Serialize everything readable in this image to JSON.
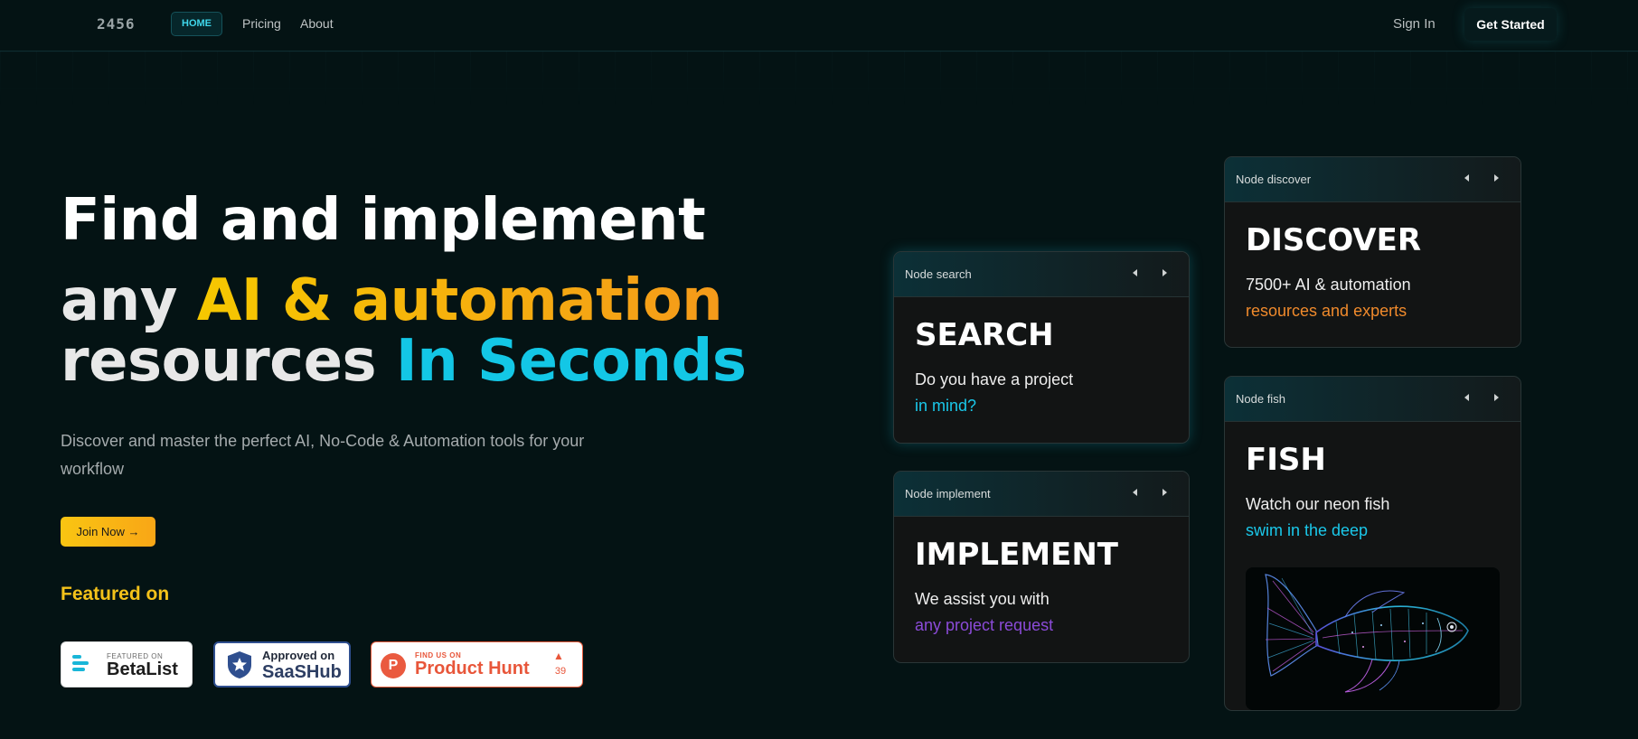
{
  "nav": {
    "logo": "2456",
    "home": "HOME",
    "pricing": "Pricing",
    "about": "About",
    "sign_in": "Sign In",
    "get_started": "Get Started"
  },
  "hero": {
    "line1": "Find and implement",
    "line2_a": "any ",
    "line2_b": "AI & automation",
    "line3_a": "resources ",
    "line3_b": "In Seconds",
    "subtitle": "Discover and master the perfect AI, No-Code & Automation tools for your workflow",
    "join_button": "Join Now →",
    "featured_heading": "Featured on"
  },
  "badges": {
    "betalist": {
      "small": "FEATURED ON",
      "big": "BetaList"
    },
    "saashub": {
      "small": "Approved on",
      "big": "SaaSHub"
    },
    "producthunt": {
      "small": "FIND US ON",
      "big": "Product Hunt",
      "icon_letter": "P",
      "upvote_arrow": "▲",
      "count": "39"
    }
  },
  "cards": {
    "search": {
      "header": "Node search",
      "title": "SEARCH",
      "line1": "Do you have a project",
      "line2": "in mind?"
    },
    "implement": {
      "header": "Node implement",
      "title": "IMPLEMENT",
      "line1": "We assist you with",
      "line2": "any project request"
    },
    "discover": {
      "header": "Node discover",
      "title": "DISCOVER",
      "line1": "7500+ AI & automation",
      "line2": "resources and experts"
    },
    "fish": {
      "header": "Node fish",
      "title": "FISH",
      "line1": "Watch our neon fish",
      "line2": "swim in the deep"
    }
  },
  "colors": {
    "background": "#041314",
    "accent_cyan": "#13c7e6",
    "accent_yellow": "#f6c800",
    "accent_orange": "#f08a2c",
    "accent_purple": "#8b4bd8"
  }
}
